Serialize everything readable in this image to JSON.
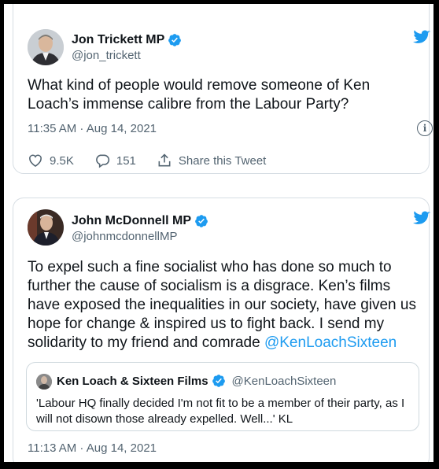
{
  "tweet1": {
    "author_name": "Jon Trickett MP",
    "author_handle": "@jon_trickett",
    "text": "What kind of people would remove someone of Ken Loach’s immense calibre from the Labour Party?",
    "timestamp": "11:35 AM · Aug 14, 2021",
    "likes": "9.5K",
    "replies": "151",
    "share_label": "Share this Tweet"
  },
  "tweet2": {
    "author_name": "John McDonnell MP",
    "author_handle": "@johnmcdonnellMP",
    "text_main": "To expel such a fine socialist who has done so much to further the cause of socialism is a disgrace. Ken’s films have exposed the inequalities in our society, have given us hope for change & inspired us to fight back. I send my solidarity to my friend and comrade ",
    "text_mention": "@KenLoachSixteen",
    "timestamp": "11:13 AM · Aug 14, 2021",
    "quote": {
      "author_name": "Ken Loach & Sixteen Films",
      "author_handle": "@KenLoachSixteen",
      "text": "'Labour HQ finally decided I'm not fit to be a member of their party, as I will not disown those already expelled. Well...' KL"
    }
  },
  "colors": {
    "twitter_blue": "#1d9bf0",
    "secondary_text": "#536471",
    "primary_text": "#0f1419",
    "frame_border": "#000000"
  },
  "icons": [
    "twitter-bird-icon",
    "verified-badge-icon",
    "info-icon",
    "heart-icon",
    "reply-icon",
    "share-icon"
  ]
}
